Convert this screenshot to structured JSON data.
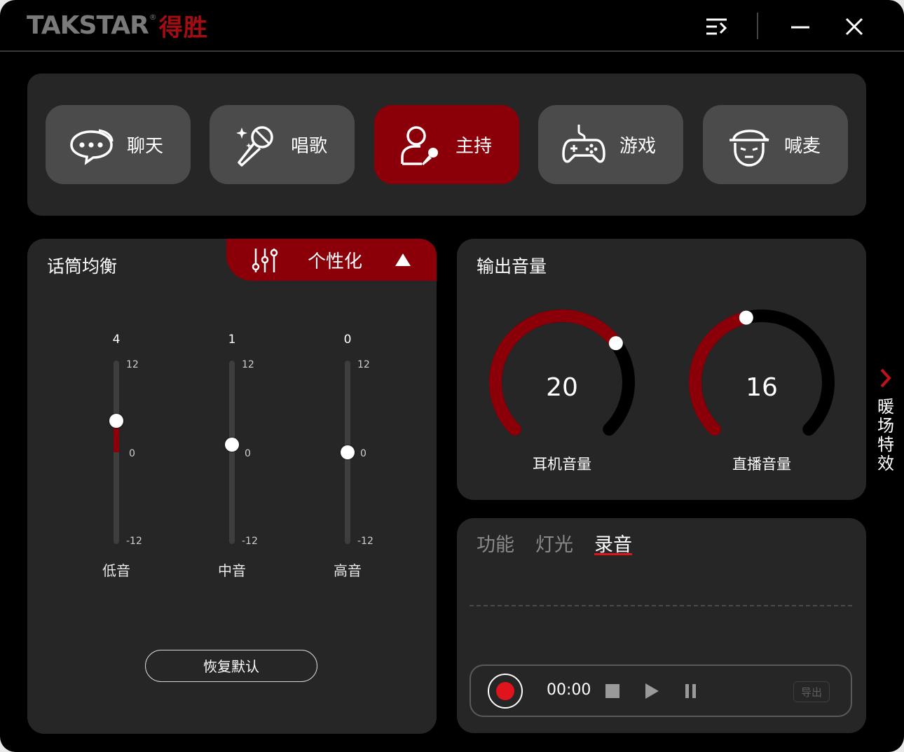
{
  "app": {
    "brand_en": "TAKSTAR",
    "brand_reg": "®",
    "brand_cn": "得胜",
    "colors": {
      "accent": "#8b0008",
      "record_red": "#e0141c",
      "panel": "#262626",
      "button": "#4b4b4b"
    }
  },
  "titlebar": {
    "icons": [
      "menu-list-icon",
      "minimize-icon",
      "close-icon"
    ]
  },
  "modes": [
    {
      "label": "聊天",
      "icon": "chat-bubble-icon",
      "active": false
    },
    {
      "label": "唱歌",
      "icon": "microphone-sparkle-icon",
      "active": false
    },
    {
      "label": "主持",
      "icon": "host-person-mic-icon",
      "active": true
    },
    {
      "label": "游戏",
      "icon": "gamepad-icon",
      "active": false
    },
    {
      "label": "喊麦",
      "icon": "cap-face-icon",
      "active": false
    }
  ],
  "eq": {
    "title": "话筒均衡",
    "preset_label": "个性化",
    "sliders": [
      {
        "name": "低音",
        "value": "4",
        "max": "12",
        "mid": "0",
        "min": "-12"
      },
      {
        "name": "中音",
        "value": "1",
        "max": "12",
        "mid": "0",
        "min": "-12"
      },
      {
        "name": "高音",
        "value": "0",
        "max": "12",
        "mid": "0",
        "min": "-12"
      }
    ],
    "reset_label": "恢复默认"
  },
  "output": {
    "title": "输出音量",
    "knobs": [
      {
        "name": "耳机音量",
        "value": "20",
        "fraction": 0.7
      },
      {
        "name": "直播音量",
        "value": "16",
        "fraction": 0.45
      }
    ]
  },
  "bottom": {
    "tabs": [
      "功能",
      "灯光",
      "录音"
    ],
    "active_tab": "录音",
    "time": "00:00",
    "export_label": "导出"
  },
  "side": {
    "label": "暖场特效"
  }
}
